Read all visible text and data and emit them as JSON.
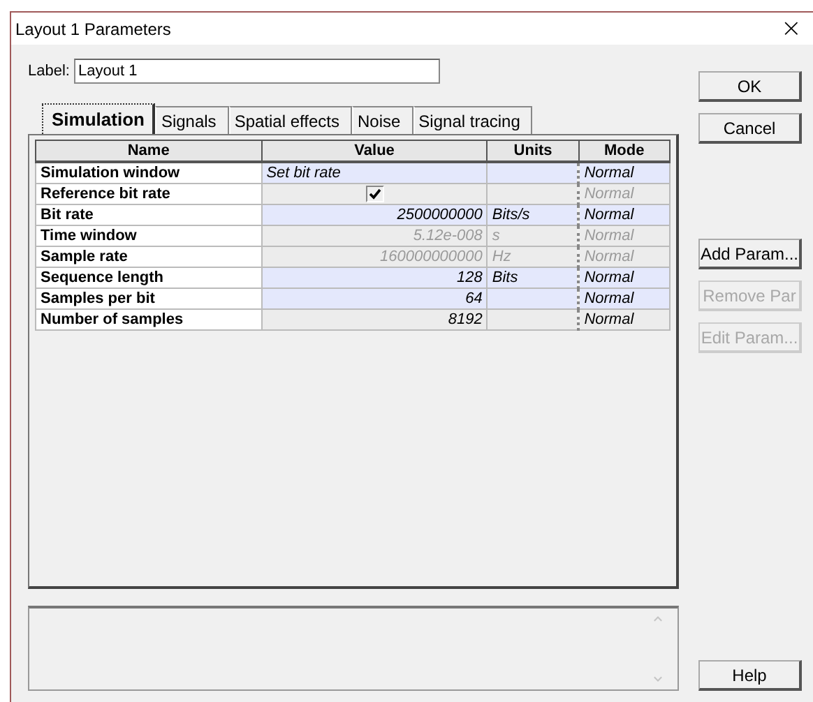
{
  "window": {
    "title": "Layout 1 Parameters",
    "close": "×"
  },
  "label": {
    "caption": "Label:",
    "value": "Layout 1"
  },
  "tabs": [
    {
      "label": "Simulation",
      "selected": true
    },
    {
      "label": "Signals",
      "selected": false
    },
    {
      "label": "Spatial effects",
      "selected": false
    },
    {
      "label": "Noise",
      "selected": false
    },
    {
      "label": "Signal tracing",
      "selected": false
    }
  ],
  "table": {
    "columns": [
      "Name",
      "Value",
      "Units",
      "Mode"
    ],
    "rows": [
      {
        "name": "Simulation window",
        "kind": "text",
        "value": "Set bit rate",
        "units": "",
        "mode": "Normal",
        "disabled": false,
        "editable": true
      },
      {
        "name": "Reference bit rate",
        "kind": "checkbox",
        "checked": true,
        "units": "",
        "mode": "Normal",
        "disabled": true,
        "editable": false
      },
      {
        "name": "Bit rate",
        "kind": "number",
        "value": "2500000000",
        "units": "Bits/s",
        "mode": "Normal",
        "disabled": false,
        "editable": true
      },
      {
        "name": "Time window",
        "kind": "number",
        "value": "5.12e-008",
        "units": "s",
        "mode": "Normal",
        "disabled": true,
        "editable": false
      },
      {
        "name": "Sample rate",
        "kind": "number",
        "value": "160000000000",
        "units": "Hz",
        "mode": "Normal",
        "disabled": true,
        "editable": false
      },
      {
        "name": "Sequence length",
        "kind": "number",
        "value": "128",
        "units": "Bits",
        "mode": "Normal",
        "disabled": false,
        "editable": true
      },
      {
        "name": "Samples per bit",
        "kind": "number",
        "value": "64",
        "units": "",
        "mode": "Normal",
        "disabled": false,
        "editable": true
      },
      {
        "name": "Number of samples",
        "kind": "number",
        "value": "8192",
        "units": "",
        "mode": "Normal",
        "disabled": false,
        "editable": false
      }
    ]
  },
  "buttons_top": [
    {
      "label": "OK",
      "disabled": false
    },
    {
      "label": "Cancel",
      "disabled": false
    }
  ],
  "buttons_side": [
    {
      "label": "Add Param...",
      "disabled": false
    },
    {
      "label": "Remove Par",
      "disabled": true
    },
    {
      "label": "Edit Param...",
      "disabled": true
    }
  ],
  "help_button": {
    "label": "Help",
    "disabled": false
  }
}
